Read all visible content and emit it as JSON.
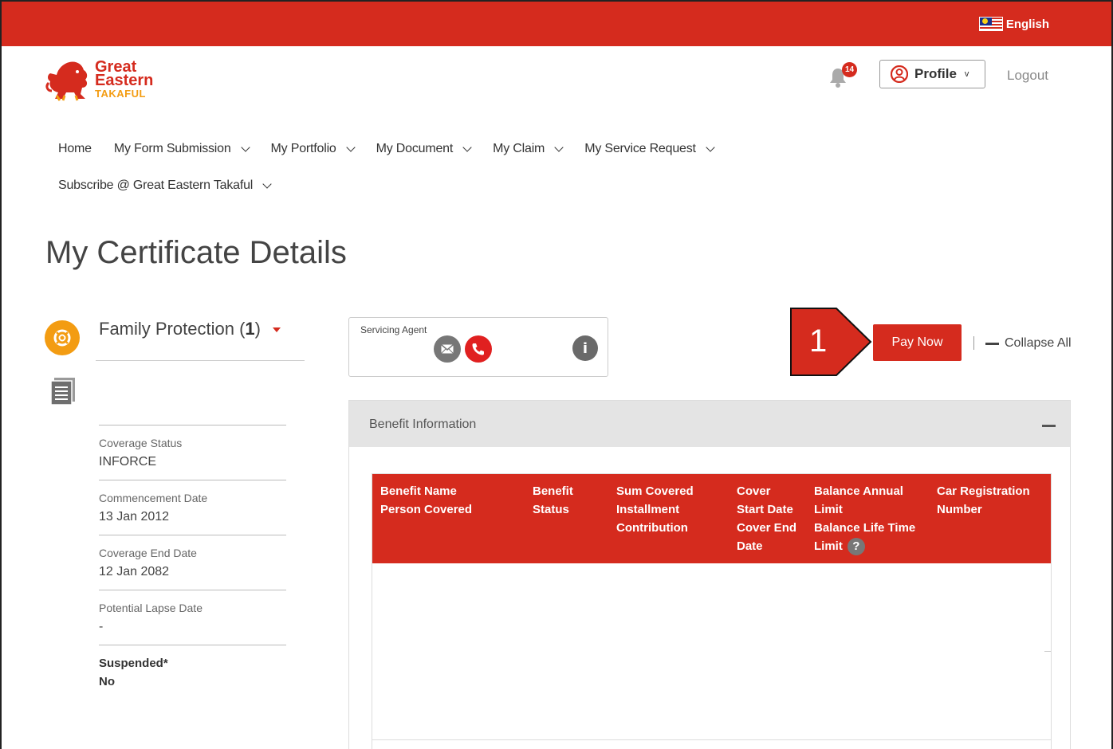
{
  "topbar": {
    "language": "English",
    "flag_icon": "malaysia-flag-icon"
  },
  "brand": {
    "line1": "Great",
    "line2": "Eastern",
    "line3": "TAKAFUL",
    "primary_color": "#d52b1e",
    "accent_color": "#f39c12"
  },
  "header": {
    "notifications_count": "14",
    "profile_label": "Profile",
    "logout_label": "Logout"
  },
  "nav": {
    "items": [
      {
        "label": "Home",
        "has_dropdown": false
      },
      {
        "label": "My Form Submission",
        "has_dropdown": true
      },
      {
        "label": "My Portfolio",
        "has_dropdown": true
      },
      {
        "label": "My Document",
        "has_dropdown": true
      },
      {
        "label": "My Claim",
        "has_dropdown": true
      },
      {
        "label": "My Service Request",
        "has_dropdown": true
      }
    ],
    "row2": {
      "label": "Subscribe @ Great Eastern Takaful",
      "has_dropdown": true
    }
  },
  "page": {
    "title": "My Certificate Details"
  },
  "plan": {
    "name": "Family Protection",
    "count_open": "(",
    "count": "1",
    "count_close": ")"
  },
  "details": [
    {
      "label": "Coverage Status",
      "value": "INFORCE"
    },
    {
      "label": "Commencement Date",
      "value": "13 Jan 2012"
    },
    {
      "label": "Coverage End Date",
      "value": "12 Jan 2082"
    },
    {
      "label": "Potential Lapse Date",
      "value": "-"
    },
    {
      "label": "Suspended*",
      "value": "No"
    }
  ],
  "agent": {
    "label": "Servicing Agent",
    "info_glyph": "i"
  },
  "annotation": {
    "step": "1"
  },
  "actions": {
    "pay_now": "Pay Now",
    "collapse_all": "Collapse All"
  },
  "benefit": {
    "title": "Benefit Information",
    "columns": {
      "c1": [
        "Benefit Name",
        "Person Covered"
      ],
      "c2": [
        "Benefit",
        "Status"
      ],
      "c3": [
        "Sum Covered",
        "Installment",
        "Contribution"
      ],
      "c4": [
        "Cover",
        "Start Date",
        "Cover End",
        "Date"
      ],
      "c5": [
        "Balance Annual",
        "Limit",
        "Balance Life Time",
        "Limit"
      ],
      "c6": [
        "Car Registration",
        "Number"
      ]
    },
    "help_glyph": "?"
  }
}
